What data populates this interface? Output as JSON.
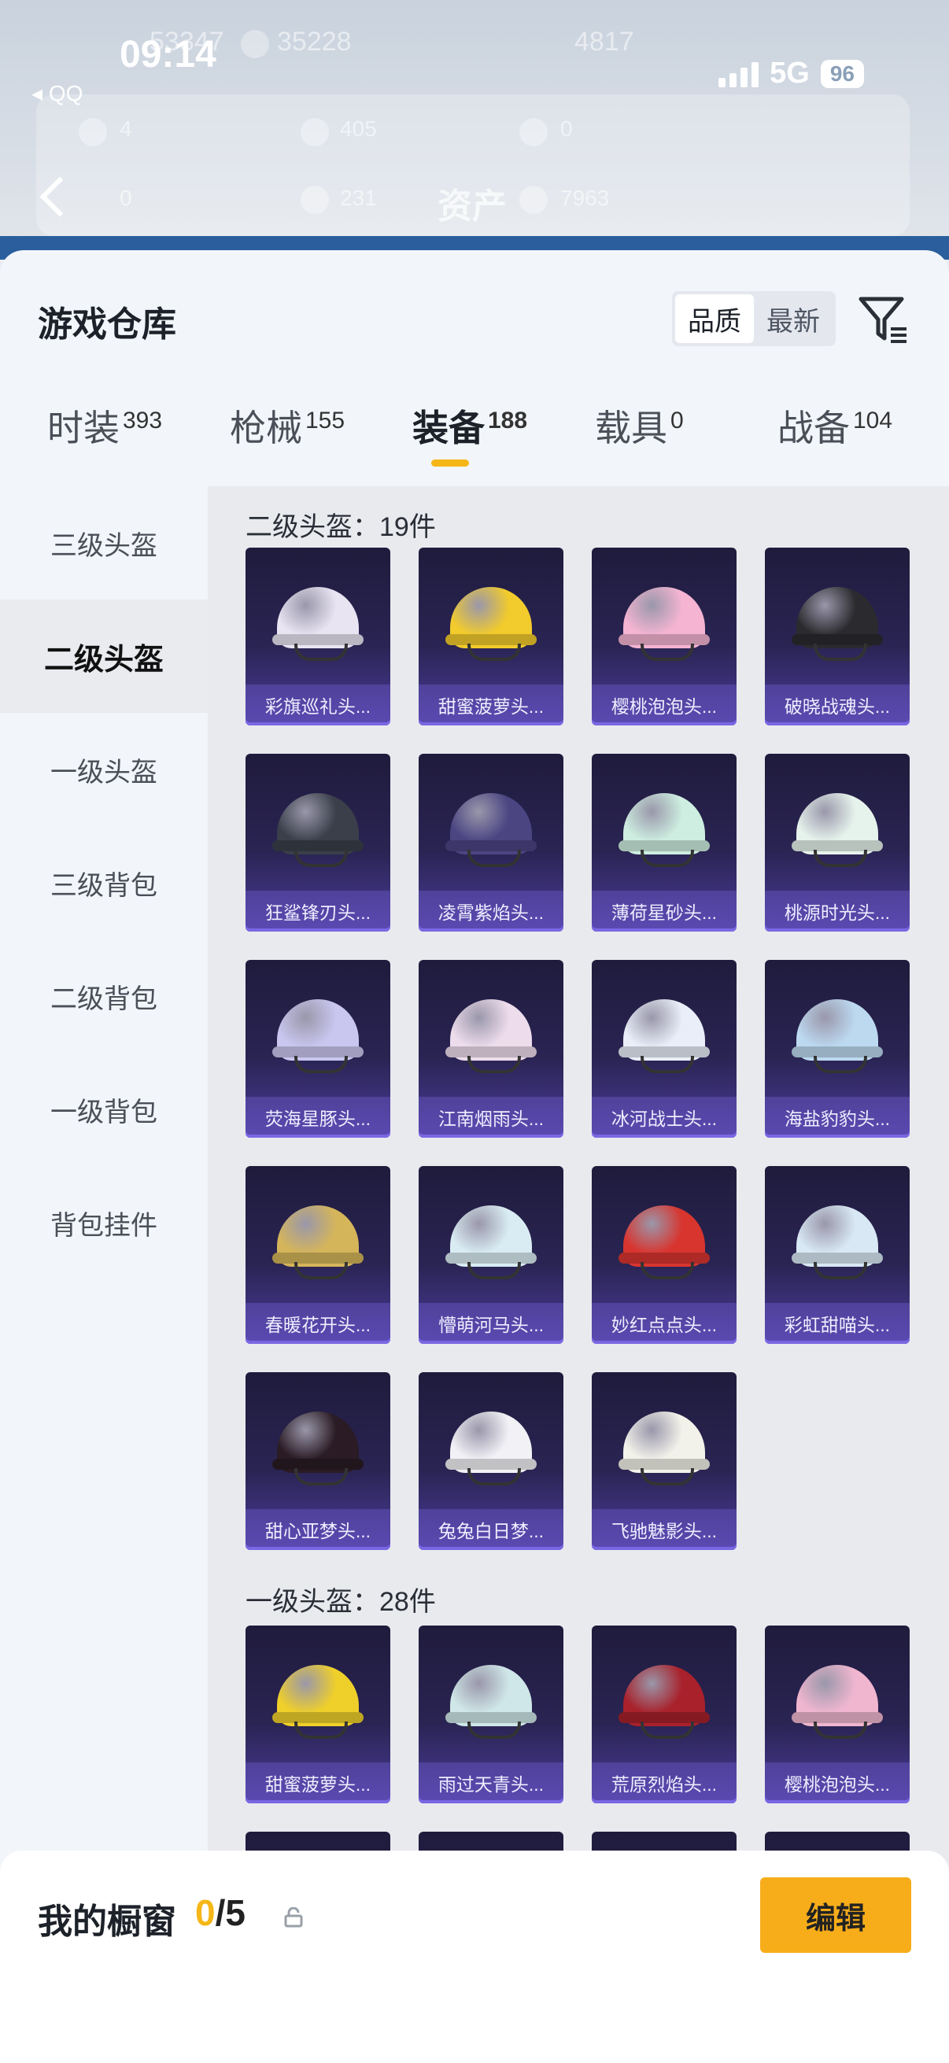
{
  "status_bar": {
    "time": "09:14",
    "back_app": "QQ",
    "network": "5G",
    "battery": "96"
  },
  "background": {
    "title": "资产",
    "stats": [
      "53347",
      "35228",
      "4817",
      "4",
      "405",
      "0",
      "0",
      "231",
      "7963"
    ]
  },
  "sheet": {
    "title": "游戏仓库",
    "sort_options": [
      "品质",
      "最新"
    ],
    "sort_selected": "品质"
  },
  "tabs": [
    {
      "label": "时装",
      "count": "393"
    },
    {
      "label": "枪械",
      "count": "155"
    },
    {
      "label": "装备",
      "count": "188"
    },
    {
      "label": "载具",
      "count": "0"
    },
    {
      "label": "战备",
      "count": "104"
    }
  ],
  "active_tab": "装备",
  "sidebar": {
    "items": [
      "三级头盔",
      "二级头盔",
      "一级头盔",
      "三级背包",
      "二级背包",
      "一级背包",
      "背包挂件"
    ],
    "active": "二级头盔"
  },
  "sections": [
    {
      "title": "二级头盔：19件",
      "items": [
        {
          "name": "彩旗巡礼头...",
          "color": "#e8e4f2"
        },
        {
          "name": "甜蜜菠萝头...",
          "color": "#f2cb2c"
        },
        {
          "name": "樱桃泡泡头...",
          "color": "#f4b4d2"
        },
        {
          "name": "破晓战魂头...",
          "color": "#2b2b2f"
        },
        {
          "name": "狂鲨锋刃头...",
          "color": "#3a3f4a"
        },
        {
          "name": "凌霄紫焰头...",
          "color": "#4b4582"
        },
        {
          "name": "薄荷星砂头...",
          "color": "#cdeee0"
        },
        {
          "name": "桃源时光头...",
          "color": "#e6f3ec"
        },
        {
          "name": "荧海星豚头...",
          "color": "#c9c6ef"
        },
        {
          "name": "江南烟雨头...",
          "color": "#eddcec"
        },
        {
          "name": "冰河战士头...",
          "color": "#e9eef8"
        },
        {
          "name": "海盐豹豹头...",
          "color": "#bcd9f0"
        },
        {
          "name": "春暖花开头...",
          "color": "#d5b55a"
        },
        {
          "name": "懵萌河马头...",
          "color": "#d9ecf3"
        },
        {
          "name": "妙红点点头...",
          "color": "#d8352f"
        },
        {
          "name": "彩虹甜喵头...",
          "color": "#d8e8f4"
        },
        {
          "name": "甜心亚梦头...",
          "color": "#2a1b24"
        },
        {
          "name": "兔兔白日梦...",
          "color": "#f2f2f6"
        },
        {
          "name": "飞驰魅影头...",
          "color": "#f3f2ea"
        }
      ]
    },
    {
      "title": "一级头盔：28件",
      "items": [
        {
          "name": "甜蜜菠萝头...",
          "color": "#efcf2a"
        },
        {
          "name": "雨过天青头...",
          "color": "#cfe7e8"
        },
        {
          "name": "荒原烈焰头...",
          "color": "#a8212b"
        },
        {
          "name": "樱桃泡泡头...",
          "color": "#f0b6cf"
        }
      ]
    }
  ],
  "showcase": {
    "label": "我的橱窗",
    "current": "0",
    "total": "/5",
    "edit_label": "编辑"
  }
}
